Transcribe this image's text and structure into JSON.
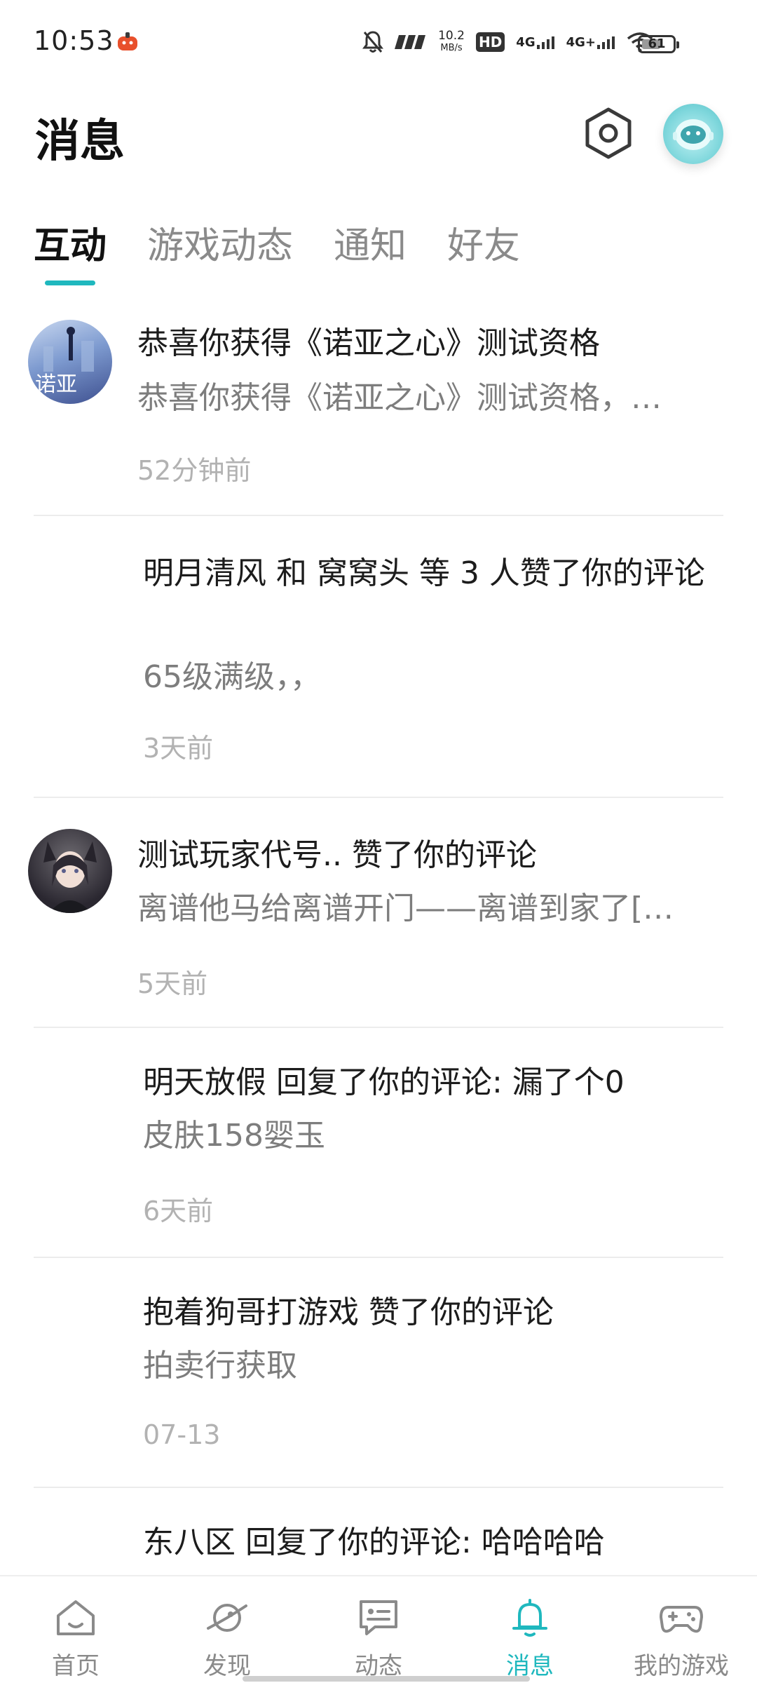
{
  "status_bar": {
    "time": "10:53",
    "net_speed_value": "10.2",
    "net_speed_unit": "MB/s",
    "hd_label": "HD",
    "network_1": "4G",
    "network_2": "4G+",
    "battery_level": 61,
    "battery_text": "61"
  },
  "header": {
    "title": "消息",
    "settings_icon": "settings-hexagon-icon",
    "avatar_icon": "astronaut-avatar"
  },
  "tabs": [
    {
      "label": "互动",
      "active": true
    },
    {
      "label": "游戏动态",
      "active": false
    },
    {
      "label": "通知",
      "active": false
    },
    {
      "label": "好友",
      "active": false
    }
  ],
  "messages": [
    {
      "title": "恭喜你获得《诺亚之心》测试资格",
      "subtitle": "恭喜你获得《诺亚之心》测试资格，…",
      "time": "52分钟前",
      "avatar": "game-noah-avatar",
      "avatar_text": "诺亚"
    },
    {
      "title": "明月清风 和 窝窝头 等 3 人赞了你的评论",
      "subtitle": "65级满级，，",
      "time": "3天前"
    },
    {
      "title": "测试玩家代号.. 赞了你的评论",
      "subtitle": "离谱他马给离谱开门——离谱到家了[…",
      "time": "5天前",
      "avatar": "anime-girl-avatar"
    },
    {
      "title": "明天放假 回复了你的评论: 漏了个0",
      "subtitle": "皮肤158婴玉",
      "time": "6天前"
    },
    {
      "title": "抱着狗哥打游戏 赞了你的评论",
      "subtitle": "拍卖行获取",
      "time": "07-13"
    },
    {
      "title": "东八区 回复了你的评论: 哈哈哈哈"
    }
  ],
  "bottom_nav": [
    {
      "label": "首页",
      "icon": "home-icon",
      "active": false
    },
    {
      "label": "发现",
      "icon": "planet-icon",
      "active": false
    },
    {
      "label": "动态",
      "icon": "chat-card-icon",
      "active": false
    },
    {
      "label": "消息",
      "icon": "bell-icon",
      "active": true
    },
    {
      "label": "我的游戏",
      "icon": "gamepad-icon",
      "active": false
    }
  ],
  "colors": {
    "accent": "#1fb8be",
    "text_primary": "#1c1c1c",
    "text_secondary": "#7d7d7d",
    "text_muted": "#b2b2b2"
  }
}
